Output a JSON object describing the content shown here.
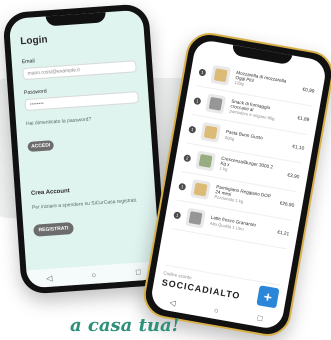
{
  "left_phone": {
    "title": "Login",
    "email_label": "Email",
    "email_value": "mario.rossi@example.it",
    "password_label": "Password",
    "password_value": "••••••••",
    "forgot_text": "Hai dimenticato la password?",
    "login_button": "ACCEDI",
    "create_title": "Crea Account",
    "create_text": "Per iniziare a spendere su SiCurCasa registrati.",
    "register_button": "REGISTRATI",
    "nav": [
      "◁",
      "○",
      "□"
    ]
  },
  "right_phone": {
    "items": [
      {
        "qty": "1",
        "name": "Mozzarella di mozzarella Oggi Più!",
        "detail": "125g",
        "price": "€0,99",
        "thumb": "alt1"
      },
      {
        "qty": "1",
        "name": "Snack di formaggio croccanti al",
        "detail": "pomodoro e origano 80g",
        "price": "€1,89",
        "thumb": "alt3"
      },
      {
        "qty": "1",
        "name": "Pasta Buon Gusto",
        "detail": "500g",
        "price": "€1,10",
        "thumb": "alt1"
      },
      {
        "qty": "2",
        "name": "Crescenza/Burger 3000 2 Kg x",
        "detail": "1 kg",
        "price": "€3,90",
        "thumb": "alt2"
      },
      {
        "qty": "1",
        "name": "Parmigiano Reggiano DOP 24 mesi",
        "detail": "Porzionato 1 kg",
        "price": "€26,90",
        "thumb": "alt1"
      },
      {
        "qty": "1",
        "name": "Latte fresco Granarolo",
        "detail": "Alta Qualità 1 Litro",
        "price": "€1,21",
        "thumb": "alt3"
      }
    ],
    "promo_label": "Codice sconto",
    "promo_code": "SOCICADIALTO",
    "plus": "+",
    "nav": [
      "◁",
      "○",
      "□"
    ]
  },
  "tagline": "a casa tua!"
}
